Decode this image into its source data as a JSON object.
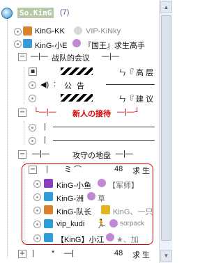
{
  "root": {
    "name": "So.KinG",
    "count": "(7)"
  },
  "members_top": [
    {
      "name": "KinG-KK",
      "badge_text": "VIP-KiNky"
    },
    {
      "name": "KinG-小E",
      "badge_text": "『国王』求生高手"
    }
  ],
  "ch1": {
    "name": "战队的会议",
    "items": [
      {
        "title": "ㄣ『 高 层",
        "num": ""
      },
      {
        "title": "公   告",
        "num": ""
      },
      {
        "title": "ㄣ『 建 议",
        "num": ""
      }
    ]
  },
  "ch2": {
    "name": "新人の接待"
  },
  "ch3": {
    "name": "攻守の地盘"
  },
  "sub": {
    "num": "48",
    "label": "求 生"
  },
  "members_bottom": [
    {
      "name": "KinG-小鱼",
      "badge_text": "【军师】"
    },
    {
      "name": "KinG-洲",
      "badge_text": "草"
    },
    {
      "name": "KinG-队长",
      "badge_text": "KinG、一只"
    },
    {
      "name": "vip_kudi",
      "badge_text": "sorpack"
    },
    {
      "name": "【KinG】小江",
      "badge_text": "★、加"
    }
  ],
  "bottom_row": {
    "num": "48",
    "label": "求 生"
  },
  "colors": {
    "red": "#d80000",
    "selection": "#cfe0f7"
  }
}
